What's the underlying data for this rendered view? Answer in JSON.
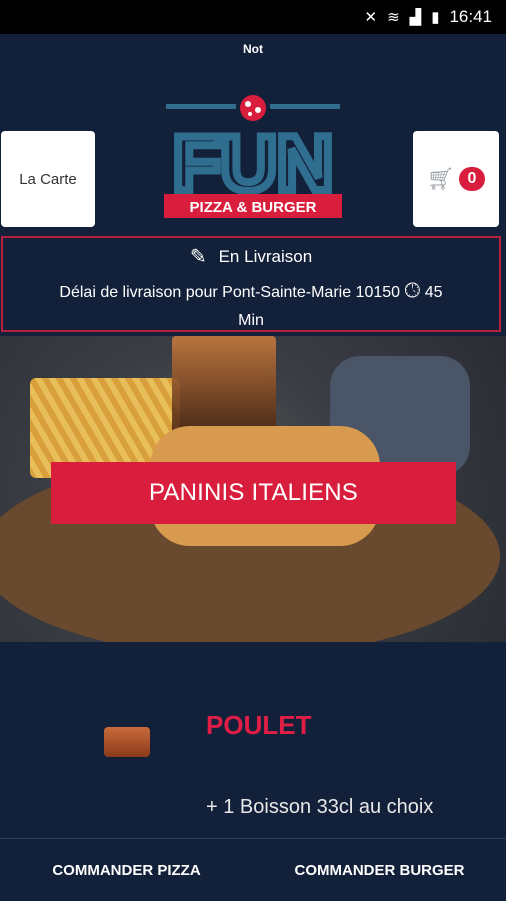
{
  "status_bar": {
    "time": "16:41"
  },
  "header": {
    "top_label": "Not",
    "carte_button": "La Carte",
    "cart_count": "0",
    "logo": {
      "word": "FUN",
      "subtitle": "PIZZA & BURGER"
    }
  },
  "delivery": {
    "mode_label": "En Livraison",
    "delay_text": "Délai de livraison pour Pont-Sainte-Marie 10150",
    "delay_value": "45",
    "delay_unit": "Min"
  },
  "hero": {
    "banner_label": "PANINIS ITALIENS"
  },
  "product": {
    "title": "POULET",
    "description": "+ 1 Boisson 33cl au choix"
  },
  "bottom_nav": {
    "pizza": "COMMANDER PIZZA",
    "burger": "COMMANDER BURGER"
  },
  "colors": {
    "accent": "#d91e3d",
    "background": "#13203a",
    "logo_blue": "#2f6e8f"
  },
  "icons": [
    "mute-icon",
    "wifi-icon",
    "signal-icon",
    "battery-icon",
    "pencil-icon",
    "clock-icon",
    "cart-icon"
  ]
}
